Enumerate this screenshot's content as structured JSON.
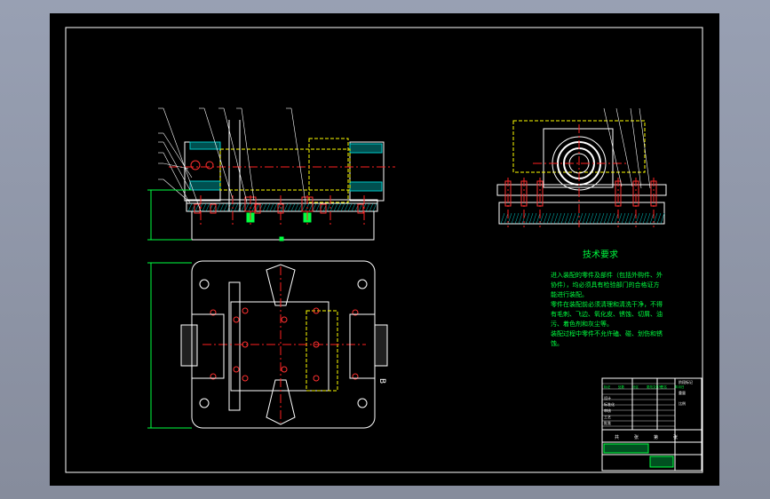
{
  "drawing": {
    "background": "#000000",
    "viewport_bg": "#8f95a8",
    "colors": {
      "outline": "#ffffff",
      "centerline": "#ff2020",
      "hidden": "#ffff00",
      "dimension": "#00ff40",
      "leader": "#ffffff",
      "hatch": "#00c8c8",
      "bolt": "#ff3030",
      "magenta": "#ff40ff"
    },
    "section_label": "B",
    "view_label": "B",
    "tech_title": "技术要求",
    "tech_lines": [
      "进入装配的零件及部件（包括外购件、外",
      "协件），均必须具有检验部门的合格证方",
      "能进行装配。",
      "零件在装配前必须清理和清洗干净，不得",
      "有毛刺、飞边、氧化皮、锈蚀、切屑、油",
      "污、着色剂和灰尘等。",
      "装配过程中零件不允许磕、碰、划伤和锈",
      "蚀。"
    ],
    "title_block": {
      "row_labels": [
        "标记",
        "处数",
        "分区",
        "更改文件号",
        "签名",
        "年月日"
      ],
      "role_labels": [
        "设计",
        "标准化",
        "审核",
        "工艺",
        "批准"
      ],
      "stage_labels": [
        "阶段标记",
        "重量",
        "比例"
      ],
      "footer_labels": [
        "共",
        "张",
        "第",
        "张"
      ]
    }
  }
}
